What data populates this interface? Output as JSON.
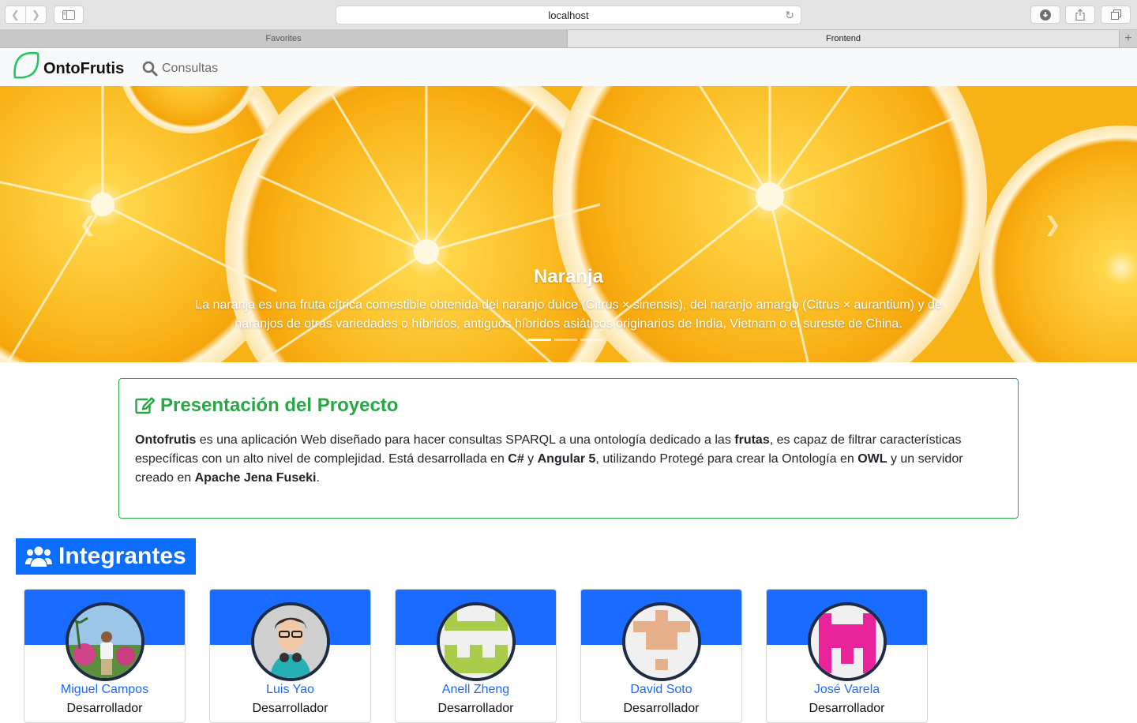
{
  "browser": {
    "url": "localhost",
    "tabs": [
      {
        "label": "Favorites"
      },
      {
        "label": "Frontend"
      }
    ],
    "new_tab": "+"
  },
  "navbar": {
    "brand": "OntoFrutis",
    "brand_color": "#22c55e",
    "links": [
      {
        "label": "Consultas",
        "icon": "search-icon"
      }
    ]
  },
  "carousel": {
    "title": "Naranja",
    "text": "La naranja es una fruta cítrica comestible obtenida del naranjo dulce (Citrus × sinensis), del naranjo amargo (Citrus × aurantium) y de naranjos de otras variedades o híbridos, antiguos híbridos asiáticos originarios de India, Vietnam o el sureste de China.",
    "slides": 3,
    "active_slide": 1,
    "prev_icon": "chevron-left-icon",
    "next_icon": "chevron-right-icon"
  },
  "project": {
    "title": "Presentación del Proyecto",
    "title_color": "#28a745",
    "icon": "edit-icon",
    "body": [
      {
        "text": "Ontofrutis",
        "bold": true
      },
      {
        "text": " es una aplicación Web diseñado para hacer consultas SPARQL a una ontología dedicado a las ",
        "bold": false
      },
      {
        "text": "frutas",
        "bold": true
      },
      {
        "text": ", es capaz de filtrar características específicas con un alto nivel de complejidad. Está desarrollada en ",
        "bold": false
      },
      {
        "text": "C#",
        "bold": true
      },
      {
        "text": " y ",
        "bold": false
      },
      {
        "text": "Angular 5",
        "bold": true
      },
      {
        "text": ", utilizando Protegé para crear la Ontología en ",
        "bold": false
      },
      {
        "text": "OWL",
        "bold": true
      },
      {
        "text": " y un servidor creado en ",
        "bold": false
      },
      {
        "text": "Apache Jena Fuseki",
        "bold": true
      },
      {
        "text": ".",
        "bold": false
      }
    ]
  },
  "team": {
    "heading": "Integrantes",
    "heading_bg": "#0d6efd",
    "icon": "users-icon",
    "members": [
      {
        "name": "Miguel Campos",
        "role": "Desarrollador",
        "avatar": "photo"
      },
      {
        "name": "Luis Yao",
        "role": "Desarrollador",
        "avatar": "photo"
      },
      {
        "name": "Anell Zheng",
        "role": "Desarrollador",
        "avatar": "identicon-green"
      },
      {
        "name": "David Soto",
        "role": "Desarrollador",
        "avatar": "identicon-tan"
      },
      {
        "name": "José Varela",
        "role": "Desarrollador",
        "avatar": "identicon-pink"
      }
    ]
  }
}
